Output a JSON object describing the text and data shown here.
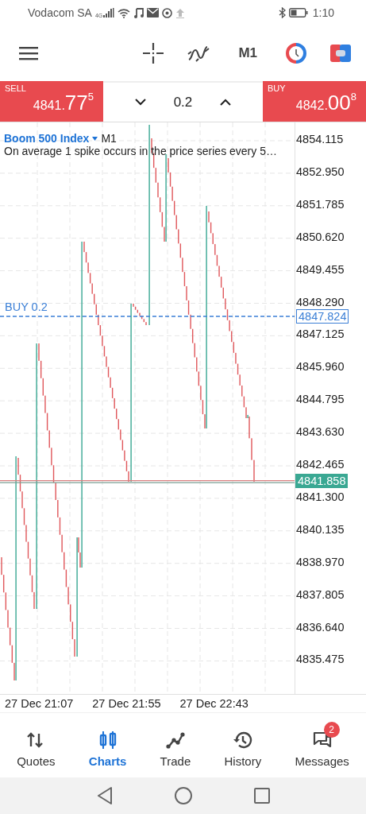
{
  "status_bar": {
    "carrier": "Vodacom SA",
    "network": "4G",
    "time": "1:10"
  },
  "toolbar": {
    "timeframe": "M1"
  },
  "trade_bar": {
    "sell": {
      "label": "SELL",
      "price_main": "4841.",
      "price_big": "77",
      "price_sup": "5"
    },
    "volume": "0.2",
    "buy": {
      "label": "BUY",
      "price_main": "4842.",
      "price_big": "00",
      "price_sup": "8"
    }
  },
  "chart": {
    "symbol": "Boom 500 Index",
    "timeframe": "M1",
    "description": "On average 1 spike occurs in the price series every 5…",
    "price_labels": [
      "4854.115",
      "4852.950",
      "4851.785",
      "4850.620",
      "4849.455",
      "4848.290",
      "4847.125",
      "4845.960",
      "4844.795",
      "4843.630",
      "4842.465",
      "4841.300",
      "4840.135",
      "4838.970",
      "4837.805",
      "4836.640",
      "4835.475"
    ],
    "order_line": {
      "label": "BUY 0.2",
      "price": "4847.824"
    },
    "current_price": "4841.858",
    "time_labels": [
      "27 Dec 21:07",
      "27 Dec 21:55",
      "27 Dec 22:43"
    ]
  },
  "nav": [
    {
      "label": "Quotes",
      "kind": "quotes",
      "selected": false
    },
    {
      "label": "Charts",
      "kind": "charts",
      "selected": true
    },
    {
      "label": "Trade",
      "kind": "trade",
      "selected": false
    },
    {
      "label": "History",
      "kind": "history",
      "selected": false
    },
    {
      "label": "Messages",
      "kind": "messages",
      "selected": false,
      "badge": "2"
    }
  ]
}
